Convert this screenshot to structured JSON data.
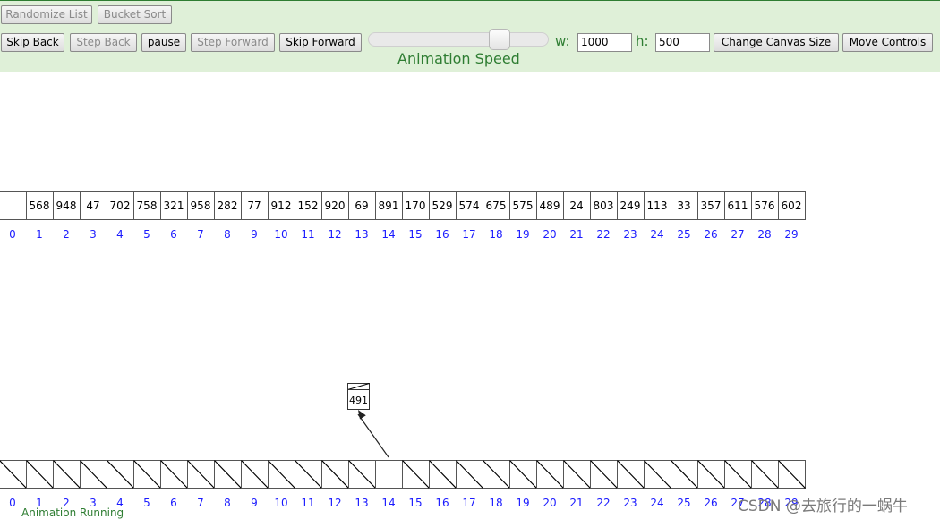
{
  "toolbar": {
    "randomize": "Randomize List",
    "bucket_sort": "Bucket Sort",
    "skip_back": "Skip Back",
    "step_back": "Step Back",
    "pause": "pause",
    "step_forward": "Step Forward",
    "skip_forward": "Skip Forward",
    "speed_label": "Animation Speed",
    "speed_value": 0.76,
    "w_label": "w:",
    "w_value": "1000",
    "h_label": "h:",
    "h_value": "500",
    "change_canvas": "Change Canvas Size",
    "move_controls": "Move Controls"
  },
  "array": {
    "values": [
      "",
      "568",
      "948",
      "47",
      "702",
      "758",
      "321",
      "958",
      "282",
      "77",
      "912",
      "152",
      "920",
      "69",
      "891",
      "170",
      "529",
      "574",
      "675",
      "575",
      "489",
      "24",
      "803",
      "249",
      "113",
      "33",
      "357",
      "611",
      "576",
      "602"
    ],
    "indices": [
      "0",
      "1",
      "2",
      "3",
      "4",
      "5",
      "6",
      "7",
      "8",
      "9",
      "10",
      "11",
      "12",
      "13",
      "14",
      "15",
      "16",
      "17",
      "18",
      "19",
      "20",
      "21",
      "22",
      "23",
      "24",
      "25",
      "26",
      "27",
      "28",
      "29"
    ]
  },
  "buckets": {
    "indices": [
      "0",
      "1",
      "2",
      "3",
      "4",
      "5",
      "6",
      "7",
      "8",
      "9",
      "10",
      "11",
      "12",
      "13",
      "14",
      "15",
      "16",
      "17",
      "18",
      "19",
      "20",
      "21",
      "22",
      "23",
      "24",
      "25",
      "26",
      "27",
      "28",
      "29"
    ],
    "empty_bucket": "14"
  },
  "moving_node": {
    "value": "491",
    "target_bucket": "14"
  },
  "colors": {
    "panel": "#dff0d8",
    "accent": "#2e7d32",
    "index": "#1a1aff"
  },
  "status": "Animation Running",
  "watermark": "CSDN @去旅行的一蜗牛"
}
